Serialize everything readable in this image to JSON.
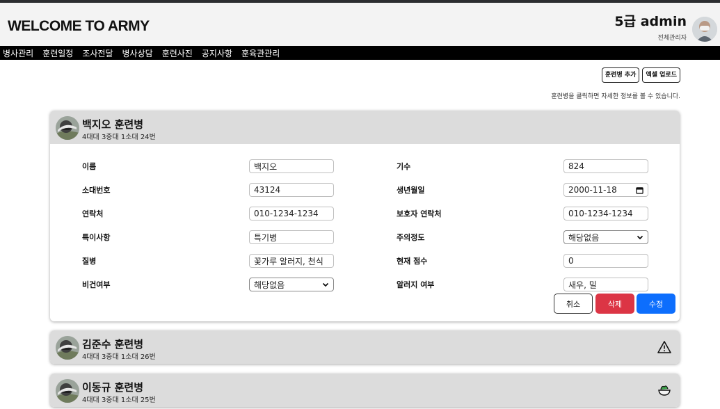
{
  "header": {
    "brand": "WELCOME TO ARMY",
    "user_name": "5급 admin",
    "user_role": "전체관리자"
  },
  "nav": [
    "병사관리",
    "훈련일정",
    "조사전달",
    "병사상담",
    "훈련사진",
    "공지사항",
    "훈육관관리"
  ],
  "actions": {
    "add_trainee": "훈련병 추가",
    "excel_upload": "엑셀 업로드",
    "hint": "훈련병을 클릭하면 자세한 정보를 볼 수 있습니다."
  },
  "cards": [
    {
      "name": "백지오 훈련병",
      "unit": "4대대 3중대 1소대 24번",
      "fields": {
        "name_label": "이름",
        "name_value": "백지오",
        "gen_label": "기수",
        "gen_value": "824",
        "squad_label": "소대번호",
        "squad_value": "43124",
        "birth_label": "생년월일",
        "birth_value": "2000-11-18",
        "phone_label": "연락처",
        "phone_value": "010-1234-1234",
        "guardian_label": "보호자 연락처",
        "guardian_value": "010-1234-1234",
        "note_label": "특이사항",
        "note_value": "특기병",
        "caution_label": "주의정도",
        "caution_value": "해당없음",
        "illness_label": "질병",
        "illness_value": "꽃가루 알러지, 천식",
        "score_label": "현재 점수",
        "score_value": "0",
        "vegan_label": "비건여부",
        "vegan_value": "해당없음",
        "allergy_label": "알러지 여부",
        "allergy_value": "새우, 밀"
      },
      "buttons": {
        "cancel": "취소",
        "delete": "삭제",
        "save": "수정"
      }
    },
    {
      "name": "김준수 훈련병",
      "unit": "4대대 3중대 1소대 26번",
      "flag": "warning-icon"
    },
    {
      "name": "이동규 훈련병",
      "unit": "4대대 3중대 1소대 25번",
      "flag": "salad-bowl-icon"
    }
  ],
  "colors": {
    "delete": "#dc3545",
    "save": "#0d6efd",
    "nav_bg": "#000000",
    "card_head": "#dcdcdc"
  }
}
